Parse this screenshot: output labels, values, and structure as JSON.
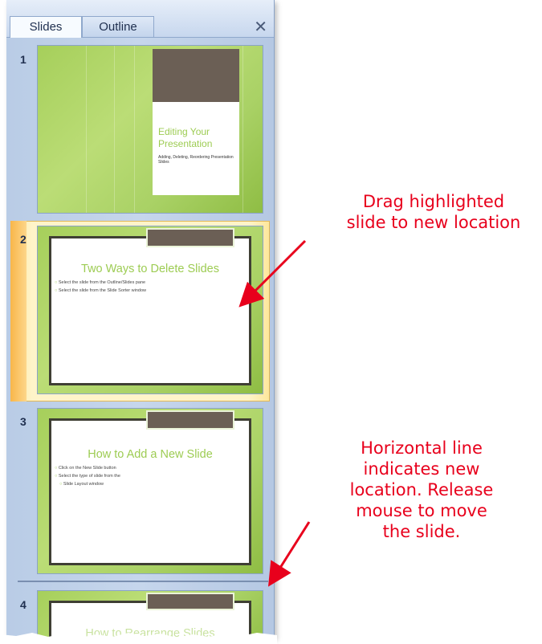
{
  "tabs": {
    "slides": "Slides",
    "outline": "Outline",
    "close_glyph": "✕"
  },
  "slides": [
    {
      "number": "1",
      "title": "Editing Your Presentation",
      "subtitle": "Adding, Deleting, Reordering Presentation Slides"
    },
    {
      "number": "2",
      "title": "Two Ways to Delete Slides",
      "bullets": [
        "Select the slide from the Outline/Slides pane",
        "Select the slide from the Slide Sorter window"
      ]
    },
    {
      "number": "3",
      "title": "How to Add a New Slide",
      "bullets": [
        "Click on the New Slide button",
        "Select the type of slide from the",
        "Slide Layout window"
      ]
    },
    {
      "number": "4",
      "title": "How to Rearrange Slides"
    }
  ],
  "callouts": {
    "drag": [
      "Drag highlighted",
      "slide to new location"
    ],
    "line": [
      "Horizontal line",
      "indicates new",
      "location.  Release",
      "mouse to move",
      "the slide."
    ]
  },
  "colors": {
    "accent_red": "#e8001c",
    "slide_green": "#9dcc53",
    "brown": "#6b5f55"
  }
}
